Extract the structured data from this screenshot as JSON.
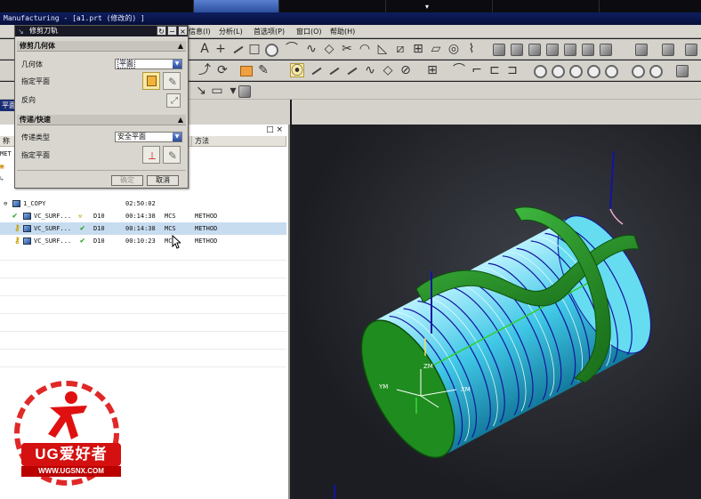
{
  "window": {
    "title": "Manufacturing - [a1.prt (修改的) ]"
  },
  "menubar": {
    "items": [
      "信息(I)",
      "分析(L)",
      "首选项(P)",
      "窗口(O)",
      "帮助(H)"
    ]
  },
  "navigator": {
    "title": "平面",
    "columns": [
      "称",
      "",
      "",
      "",
      "",
      "方法"
    ],
    "root_fragment": "MET",
    "program": {
      "name": "1_COPY",
      "time": "02:50:02"
    },
    "operations": [
      {
        "name": "VC_SURF...",
        "tool": "D10",
        "time": "00:14:38",
        "geometry": "MCS",
        "method": "METHOD"
      },
      {
        "name": "VC_SURF...",
        "tool": "D10",
        "time": "00:14:38",
        "geometry": "MCS",
        "method": "METHOD"
      },
      {
        "name": "VC_SURF...",
        "tool": "D10",
        "time": "00:10:23",
        "geometry": "MCS",
        "method": "METHOD"
      }
    ]
  },
  "dialog": {
    "title": "修剪刀轨",
    "section_geometry": "修剪几何体",
    "geometry_label": "几何体",
    "geometry_value": "平面",
    "plane_label": "指定平面",
    "reverse_label": "反向",
    "section_transfer": "传递/快速",
    "transfer_type_label": "传递类型",
    "transfer_type_value": "安全平面",
    "transfer_plane_label": "指定平面",
    "ok_label": "确定",
    "cancel_label": "取消"
  },
  "viewport": {
    "axis_labels": {
      "zm": "ZM",
      "ym": "YM",
      "xm": "XM"
    },
    "colors": {
      "part_green": "#1f8c1f",
      "cylinder_cyan": "#4fd0e8",
      "toolpath_blue": "#1414a0"
    }
  },
  "watermark": {
    "brand": "UG爱好者",
    "url": "WWW.UGSNX.COM"
  }
}
